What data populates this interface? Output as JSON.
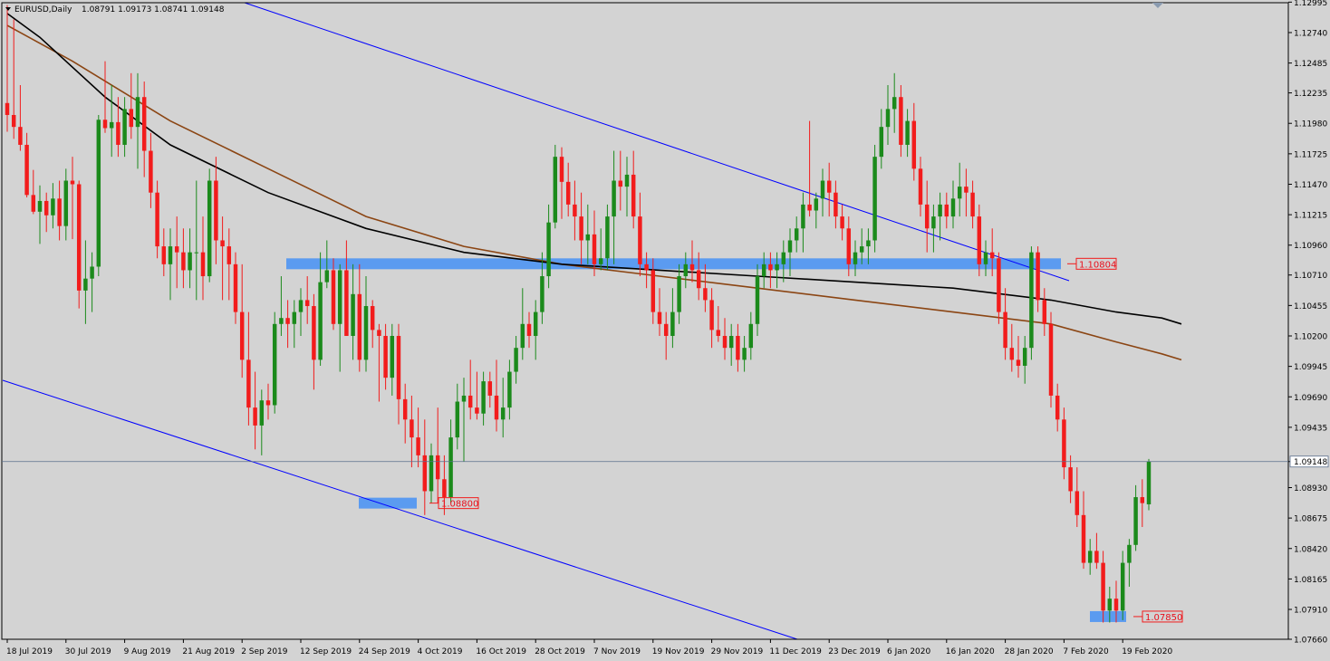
{
  "chart_data": {
    "type": "candlestick",
    "symbol_title": "EURUSD,Daily",
    "ohlc_header": "1.08791 1.09173 1.08741 1.09148",
    "current_price_label": "1.09148",
    "current_price": 1.09148,
    "y_ticks": [
      "1.12995",
      "1.12740",
      "1.12485",
      "1.12235",
      "1.11980",
      "1.11725",
      "1.11470",
      "1.11215",
      "1.10960",
      "1.10710",
      "1.10455",
      "1.10200",
      "1.09945",
      "1.09690",
      "1.09435",
      "1.09148",
      "1.08930",
      "1.08675",
      "1.08420",
      "1.08165",
      "1.07910",
      "1.07660"
    ],
    "x_ticks": [
      "18 Jul 2019",
      "30 Jul 2019",
      "9 Aug 2019",
      "21 Aug 2019",
      "2 Sep 2019",
      "12 Sep 2019",
      "24 Sep 2019",
      "4 Oct 2019",
      "16 Oct 2019",
      "28 Oct 2019",
      "7 Nov 2019",
      "19 Nov 2019",
      "29 Nov 2019",
      "11 Dec 2019",
      "23 Dec 2019",
      "6 Jan 2020",
      "16 Jan 2020",
      "28 Jan 2020",
      "7 Feb 2020",
      "19 Feb 2020"
    ],
    "ylim": [
      1.0766,
      1.1299
    ],
    "level_labels": [
      {
        "label": "1.10804",
        "value": 1.10804
      },
      {
        "label": "1.08800",
        "value": 1.088
      },
      {
        "label": "1.07850",
        "value": 1.0785
      }
    ],
    "colors": {
      "up": "#1b8a1b",
      "down": "#f21c1c",
      "ma_long": "#000000",
      "ma_short": "#8b4513",
      "trendline": "#0000ff",
      "zone": "#5b9bf0",
      "background": "#d3d3d3",
      "price_line": "#5a6e8c"
    },
    "candles": [
      [
        1.1215,
        1.1297,
        1.1191,
        1.1205
      ],
      [
        1.1205,
        1.1285,
        1.1185,
        1.1195
      ],
      [
        1.1195,
        1.123,
        1.1175,
        1.118
      ],
      [
        1.118,
        1.119,
        1.1136,
        1.1138
      ],
      [
        1.1138,
        1.1159,
        1.1122,
        1.1124
      ],
      [
        1.1124,
        1.1146,
        1.1097,
        1.1133
      ],
      [
        1.1133,
        1.114,
        1.1107,
        1.1121
      ],
      [
        1.1121,
        1.1148,
        1.111,
        1.1135
      ],
      [
        1.1135,
        1.115,
        1.11,
        1.1112
      ],
      [
        1.1112,
        1.116,
        1.11,
        1.115
      ],
      [
        1.115,
        1.117,
        1.1101,
        1.1147
      ],
      [
        1.1147,
        1.115,
        1.1043,
        1.1058
      ],
      [
        1.1058,
        1.11,
        1.103,
        1.1068
      ],
      [
        1.1068,
        1.109,
        1.104,
        1.1078
      ],
      [
        1.1078,
        1.1205,
        1.107,
        1.1201
      ],
      [
        1.1201,
        1.125,
        1.119,
        1.1194
      ],
      [
        1.1194,
        1.123,
        1.117,
        1.1199
      ],
      [
        1.1199,
        1.122,
        1.117,
        1.118
      ],
      [
        1.118,
        1.122,
        1.117,
        1.121
      ],
      [
        1.121,
        1.124,
        1.1185,
        1.1195
      ],
      [
        1.1195,
        1.124,
        1.116,
        1.122
      ],
      [
        1.122,
        1.1233,
        1.1153,
        1.1175
      ],
      [
        1.1175,
        1.119,
        1.1127,
        1.114
      ],
      [
        1.114,
        1.115,
        1.1085,
        1.1095
      ],
      [
        1.1095,
        1.111,
        1.107,
        1.108
      ],
      [
        1.108,
        1.111,
        1.105,
        1.1095
      ],
      [
        1.1095,
        1.112,
        1.106,
        1.109
      ],
      [
        1.109,
        1.111,
        1.106,
        1.1075
      ],
      [
        1.1075,
        1.111,
        1.106,
        1.109
      ],
      [
        1.109,
        1.115,
        1.105,
        1.109
      ],
      [
        1.109,
        1.112,
        1.105,
        1.107
      ],
      [
        1.107,
        1.116,
        1.1065,
        1.115
      ],
      [
        1.115,
        1.117,
        1.108,
        1.11
      ],
      [
        1.11,
        1.112,
        1.105,
        1.1095
      ],
      [
        1.1095,
        1.111,
        1.105,
        1.108
      ],
      [
        1.108,
        1.109,
        1.103,
        1.104
      ],
      [
        1.104,
        1.108,
        1.0985,
        1.1
      ],
      [
        1.1,
        1.104,
        1.0945,
        1.096
      ],
      [
        1.096,
        1.099,
        1.0925,
        1.0945
      ],
      [
        1.0945,
        1.0975,
        1.092,
        1.0966
      ],
      [
        1.0966,
        1.098,
        1.095,
        1.0962
      ],
      [
        1.0962,
        1.104,
        1.0955,
        1.103
      ],
      [
        1.103,
        1.107,
        1.102,
        1.1035
      ],
      [
        1.1035,
        1.105,
        1.101,
        1.103
      ],
      [
        1.103,
        1.105,
        1.101,
        1.104
      ],
      [
        1.104,
        1.106,
        1.102,
        1.105
      ],
      [
        1.105,
        1.107,
        1.103,
        1.1045
      ],
      [
        1.1045,
        1.1055,
        1.0975,
        1.1
      ],
      [
        1.1,
        1.109,
        1.0995,
        1.1065
      ],
      [
        1.1065,
        1.11,
        1.106,
        1.1075
      ],
      [
        1.1075,
        1.1085,
        1.1025,
        1.103
      ],
      [
        1.103,
        1.108,
        1.099,
        1.1075
      ],
      [
        1.1075,
        1.11,
        1.102,
        1.102
      ],
      [
        1.102,
        1.108,
        1.1,
        1.1055
      ],
      [
        1.1055,
        1.108,
        1.099,
        1.1
      ],
      [
        1.1,
        1.107,
        1.099,
        1.1045
      ],
      [
        1.1045,
        1.105,
        1.101,
        1.1025
      ],
      [
        1.1025,
        1.103,
        1.0965,
        1.102
      ],
      [
        1.102,
        1.103,
        1.0975,
        1.0985
      ],
      [
        1.0985,
        1.103,
        1.097,
        1.102
      ],
      [
        1.102,
        1.103,
        1.0946,
        1.0967
      ],
      [
        1.0967,
        1.098,
        1.093,
        1.095
      ],
      [
        1.095,
        1.097,
        1.091,
        1.0935
      ],
      [
        1.0935,
        1.096,
        1.091,
        1.092
      ],
      [
        1.092,
        1.095,
        1.087,
        1.089
      ],
      [
        1.089,
        1.093,
        1.088,
        1.092
      ],
      [
        1.092,
        1.096,
        1.088,
        1.09
      ],
      [
        1.09,
        1.092,
        1.087,
        1.0885
      ],
      [
        1.0885,
        1.095,
        1.088,
        1.0935
      ],
      [
        1.0935,
        1.098,
        1.0925,
        1.0965
      ],
      [
        1.0965,
        1.0985,
        1.0915,
        1.097
      ],
      [
        1.097,
        1.1,
        1.095,
        1.096
      ],
      [
        1.096,
        1.099,
        1.095,
        1.0955
      ],
      [
        1.0955,
        1.099,
        1.0945,
        1.0982
      ],
      [
        1.0982,
        1.099,
        1.096,
        1.097
      ],
      [
        1.097,
        1.1,
        1.094,
        1.095
      ],
      [
        1.095,
        1.0985,
        1.0935,
        1.096
      ],
      [
        1.096,
        1.1,
        1.095,
        1.099
      ],
      [
        1.099,
        1.102,
        1.098,
        1.101
      ],
      [
        1.101,
        1.106,
        1.1,
        1.103
      ],
      [
        1.103,
        1.104,
        1.101,
        1.102
      ],
      [
        1.102,
        1.105,
        1.1,
        1.104
      ],
      [
        1.104,
        1.109,
        1.103,
        1.107
      ],
      [
        1.107,
        1.113,
        1.106,
        1.1115
      ],
      [
        1.1115,
        1.118,
        1.111,
        1.117
      ],
      [
        1.117,
        1.1178,
        1.1118,
        1.1149
      ],
      [
        1.1149,
        1.1165,
        1.112,
        1.113
      ],
      [
        1.113,
        1.115,
        1.11,
        1.112
      ],
      [
        1.112,
        1.114,
        1.108,
        1.11
      ],
      [
        1.11,
        1.113,
        1.108,
        1.1105
      ],
      [
        1.1105,
        1.1125,
        1.107,
        1.108
      ],
      [
        1.108,
        1.111,
        1.1075,
        1.1085
      ],
      [
        1.1085,
        1.113,
        1.1075,
        1.112
      ],
      [
        1.112,
        1.1175,
        1.108,
        1.115
      ],
      [
        1.115,
        1.1175,
        1.1125,
        1.1145
      ],
      [
        1.1145,
        1.117,
        1.112,
        1.1155
      ],
      [
        1.1155,
        1.1175,
        1.111,
        1.112
      ],
      [
        1.112,
        1.114,
        1.107,
        1.108
      ],
      [
        1.108,
        1.109,
        1.106,
        1.1075
      ],
      [
        1.1075,
        1.1085,
        1.103,
        1.104
      ],
      [
        1.104,
        1.106,
        1.102,
        1.103
      ],
      [
        1.103,
        1.104,
        1.1,
        1.102
      ],
      [
        1.102,
        1.106,
        1.101,
        1.104
      ],
      [
        1.104,
        1.108,
        1.103,
        1.107
      ],
      [
        1.107,
        1.109,
        1.106,
        1.108
      ],
      [
        1.108,
        1.11,
        1.1065,
        1.1075
      ],
      [
        1.1075,
        1.109,
        1.105,
        1.106
      ],
      [
        1.106,
        1.108,
        1.104,
        1.105
      ],
      [
        1.105,
        1.106,
        1.101,
        1.1025
      ],
      [
        1.1025,
        1.1045,
        1.1015,
        1.102
      ],
      [
        1.102,
        1.1035,
        1.1,
        1.101
      ],
      [
        1.101,
        1.103,
        1.0995,
        1.102
      ],
      [
        1.102,
        1.103,
        1.099,
        1.1
      ],
      [
        1.1,
        1.102,
        1.099,
        1.101
      ],
      [
        1.101,
        1.104,
        1.1,
        1.103
      ],
      [
        1.103,
        1.108,
        1.102,
        1.107
      ],
      [
        1.107,
        1.109,
        1.106,
        1.108
      ],
      [
        1.108,
        1.109,
        1.106,
        1.1075
      ],
      [
        1.1075,
        1.109,
        1.106,
        1.108
      ],
      [
        1.108,
        1.11,
        1.1065,
        1.109
      ],
      [
        1.109,
        1.111,
        1.107,
        1.11
      ],
      [
        1.11,
        1.112,
        1.109,
        1.111
      ],
      [
        1.111,
        1.114,
        1.109,
        1.113
      ],
      [
        1.113,
        1.12,
        1.112,
        1.1125
      ],
      [
        1.1125,
        1.114,
        1.111,
        1.1135
      ],
      [
        1.1135,
        1.116,
        1.112,
        1.115
      ],
      [
        1.115,
        1.1165,
        1.112,
        1.114
      ],
      [
        1.114,
        1.115,
        1.111,
        1.112
      ],
      [
        1.112,
        1.113,
        1.11,
        1.111
      ],
      [
        1.111,
        1.112,
        1.107,
        1.108
      ],
      [
        1.108,
        1.11,
        1.107,
        1.109
      ],
      [
        1.109,
        1.111,
        1.108,
        1.1095
      ],
      [
        1.1095,
        1.111,
        1.108,
        1.11
      ],
      [
        1.11,
        1.118,
        1.109,
        1.117
      ],
      [
        1.117,
        1.121,
        1.116,
        1.1195
      ],
      [
        1.1195,
        1.123,
        1.118,
        1.121
      ],
      [
        1.121,
        1.124,
        1.119,
        1.122
      ],
      [
        1.122,
        1.123,
        1.117,
        1.118
      ],
      [
        1.118,
        1.121,
        1.117,
        1.12
      ],
      [
        1.12,
        1.1215,
        1.115,
        1.116
      ],
      [
        1.116,
        1.117,
        1.112,
        1.113
      ],
      [
        1.113,
        1.115,
        1.109,
        1.111
      ],
      [
        1.111,
        1.113,
        1.109,
        1.112
      ],
      [
        1.112,
        1.114,
        1.11,
        1.113
      ],
      [
        1.113,
        1.114,
        1.111,
        1.112
      ],
      [
        1.112,
        1.115,
        1.111,
        1.1135
      ],
      [
        1.1135,
        1.1165,
        1.112,
        1.1145
      ],
      [
        1.1145,
        1.116,
        1.112,
        1.114
      ],
      [
        1.114,
        1.115,
        1.111,
        1.112
      ],
      [
        1.112,
        1.113,
        1.107,
        1.108
      ],
      [
        1.108,
        1.11,
        1.107,
        1.109
      ],
      [
        1.109,
        1.111,
        1.107,
        1.1085
      ],
      [
        1.1085,
        1.109,
        1.103,
        1.104
      ],
      [
        1.104,
        1.106,
        1.1,
        1.101
      ],
      [
        1.101,
        1.103,
        1.099,
        1.1
      ],
      [
        1.1,
        1.102,
        1.0985,
        1.0995
      ],
      [
        1.0995,
        1.102,
        1.098,
        1.101
      ],
      [
        1.101,
        1.1095,
        1.1,
        1.109
      ],
      [
        1.109,
        1.1095,
        1.104,
        1.105
      ],
      [
        1.105,
        1.106,
        1.102,
        1.103
      ],
      [
        1.103,
        1.104,
        1.096,
        1.097
      ],
      [
        1.097,
        1.098,
        1.094,
        1.095
      ],
      [
        1.095,
        1.096,
        1.09,
        1.091
      ],
      [
        1.091,
        1.092,
        1.088,
        1.089
      ],
      [
        1.089,
        1.091,
        1.086,
        1.087
      ],
      [
        1.087,
        1.089,
        1.0825,
        1.083
      ],
      [
        1.083,
        1.085,
        1.082,
        1.084
      ],
      [
        1.084,
        1.0855,
        1.0825,
        1.083
      ],
      [
        1.083,
        1.084,
        1.078,
        1.079
      ],
      [
        1.079,
        1.081,
        1.078,
        1.08
      ],
      [
        1.08,
        1.0815,
        1.078,
        1.079
      ],
      [
        1.079,
        1.084,
        1.0782,
        1.083
      ],
      [
        1.083,
        1.085,
        1.081,
        1.0845
      ],
      [
        1.0845,
        1.0895,
        1.084,
        1.0885
      ],
      [
        1.0885,
        1.09,
        1.086,
        1.088
      ],
      [
        1.0879,
        1.0917,
        1.0874,
        1.0915
      ]
    ],
    "ma_long": [
      [
        1.129,
        0
      ],
      [
        1.127,
        5
      ],
      [
        1.122,
        15
      ],
      [
        1.118,
        25
      ],
      [
        1.114,
        40
      ],
      [
        1.111,
        55
      ],
      [
        1.109,
        70
      ],
      [
        1.108,
        85
      ],
      [
        1.1075,
        100
      ],
      [
        1.107,
        115
      ],
      [
        1.1065,
        130
      ],
      [
        1.106,
        145
      ],
      [
        1.105,
        160
      ],
      [
        1.104,
        170
      ],
      [
        1.1035,
        177
      ],
      [
        1.103,
        180
      ]
    ],
    "ma_short": [
      [
        1.128,
        0
      ],
      [
        1.125,
        10
      ],
      [
        1.12,
        25
      ],
      [
        1.116,
        40
      ],
      [
        1.112,
        55
      ],
      [
        1.1095,
        70
      ],
      [
        1.108,
        85
      ],
      [
        1.107,
        100
      ],
      [
        1.106,
        115
      ],
      [
        1.105,
        130
      ],
      [
        1.104,
        145
      ],
      [
        1.103,
        160
      ],
      [
        1.1015,
        170
      ],
      [
        1.1005,
        177
      ],
      [
        1.1,
        180
      ]
    ]
  }
}
